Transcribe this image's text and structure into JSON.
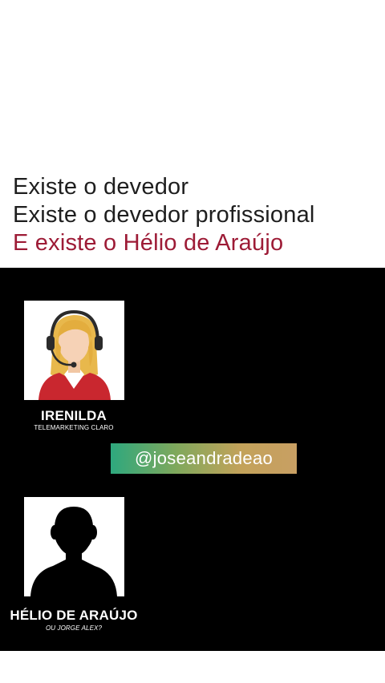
{
  "headline": {
    "line1": "Existe  o  devedor",
    "line2": "Existe o devedor profissional",
    "line3": "E existe o Hélio de Araújo",
    "accent_color": "#9d1b36"
  },
  "video": {
    "person1": {
      "name": "IRENILDA",
      "role": "TELEMARKETING CLARO",
      "icon": "telemarketing-operator-with-headset"
    },
    "handle": "@joseandradeao",
    "person2": {
      "name": "HÉLIO DE ARAÚJO",
      "alias": "OU JORGE ALEX?",
      "icon": "anonymous-person-silhouette"
    }
  }
}
